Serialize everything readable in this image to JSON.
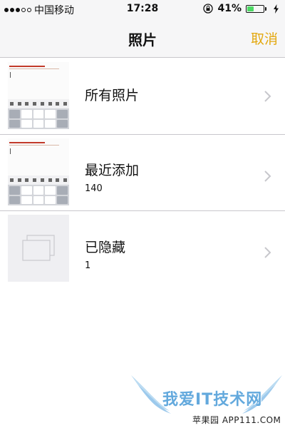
{
  "status_bar": {
    "carrier": "中国移动",
    "time": "17:28",
    "battery_percent": "41%",
    "battery_level": 0.41,
    "battery_color": "#4cd964"
  },
  "nav": {
    "title": "照片",
    "cancel_label": "取消",
    "accent_color": "#e3a80f"
  },
  "albums": [
    {
      "name": "所有照片",
      "count": "",
      "thumb": "screenshot-thumbnail"
    },
    {
      "name": "最近添加",
      "count": "140",
      "thumb": "screenshot-thumbnail"
    },
    {
      "name": "已隐藏",
      "count": "1",
      "thumb": "stacked-photos-icon"
    }
  ],
  "watermark": {
    "title": "我爱IT技术网",
    "subtitle": "苹果园 APP111.COM"
  }
}
